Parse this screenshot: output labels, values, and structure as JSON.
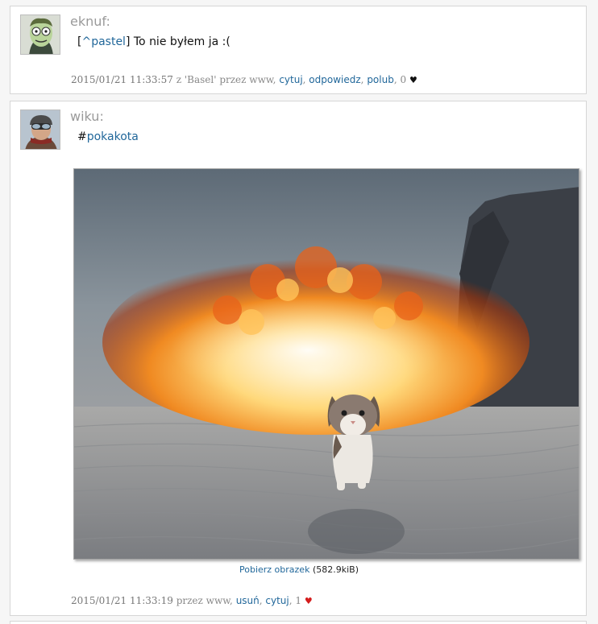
{
  "posts": [
    {
      "author": "eknuf:",
      "reply_open": "[",
      "reply_link": "^pastel",
      "reply_close": "] ",
      "text": "To nie byłem ja :(",
      "meta": {
        "timestamp": "2015/01/21 11:33:57",
        "z_label": " z ",
        "location": "'Basel'",
        "przez": " przez www, ",
        "actions": [
          "cytuj",
          "odpowiedz",
          "polub"
        ],
        "likes": "0"
      }
    },
    {
      "author": "wiku:",
      "hashtag": "#",
      "hashtag_link": "pokakota",
      "image": {
        "download_label": "Pobierz obrazek",
        "size": "(582.9kiB)"
      },
      "meta": {
        "timestamp": "2015/01/21 11:33:19",
        "przez": " przez www, ",
        "actions": [
          "usuń",
          "cytuj"
        ],
        "likes": "1"
      }
    }
  ],
  "colors": {
    "link": "#21679a",
    "author": "#9a9a9a",
    "heart_liked": "#d41c1c",
    "heart_unliked": "#111111"
  },
  "icons": {
    "heart_black": "♥",
    "heart_red": "♥"
  }
}
